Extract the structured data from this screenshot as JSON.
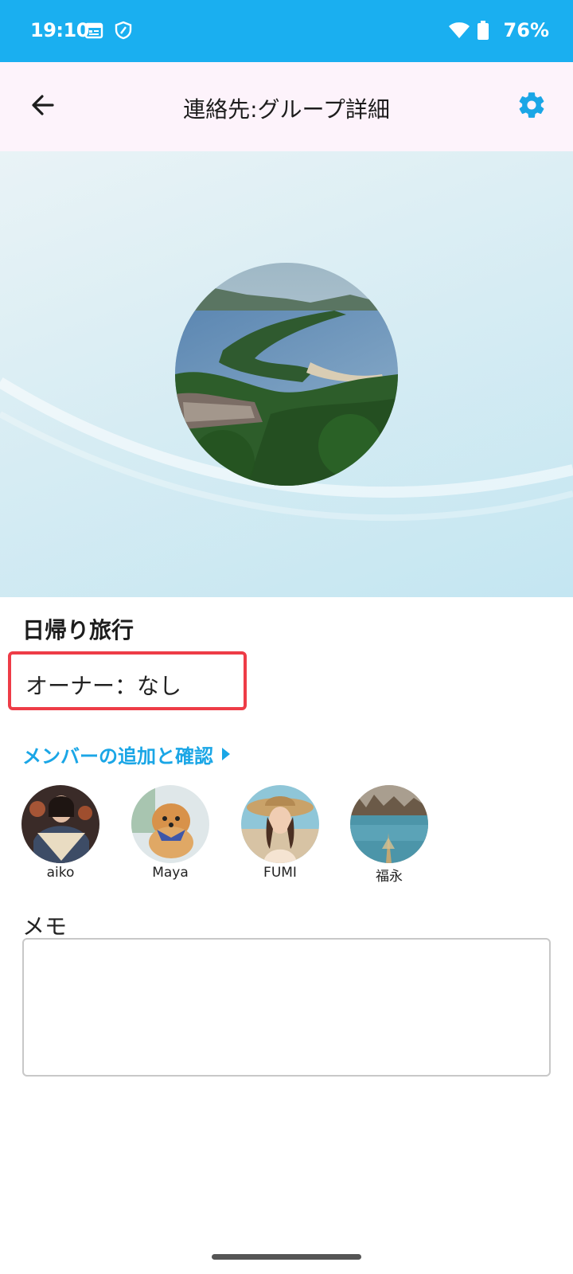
{
  "status_bar": {
    "time": "19:10",
    "battery_pct": "76%",
    "icons": [
      "calendar-icon",
      "shield-icon",
      "wifi-icon",
      "battery-icon"
    ]
  },
  "app_bar": {
    "title": "連絡先:グループ詳細",
    "back_icon": "back-arrow-icon",
    "settings_icon": "gear-icon",
    "accent": "#1aa6e6"
  },
  "group": {
    "name": "日帰り旅行",
    "owner": "オーナー：なし",
    "members_link": "メンバーの追加と確認",
    "members": [
      {
        "name": "aiko"
      },
      {
        "name": "Maya"
      },
      {
        "name": "FUMI"
      },
      {
        "name": "福永"
      }
    ]
  },
  "memo": {
    "label": "メモ",
    "value": ""
  },
  "colors": {
    "status_bar": "#1aaff0",
    "app_bar": "#fdf3fb",
    "highlight": "#ee3c47",
    "link": "#1aa6e6"
  }
}
